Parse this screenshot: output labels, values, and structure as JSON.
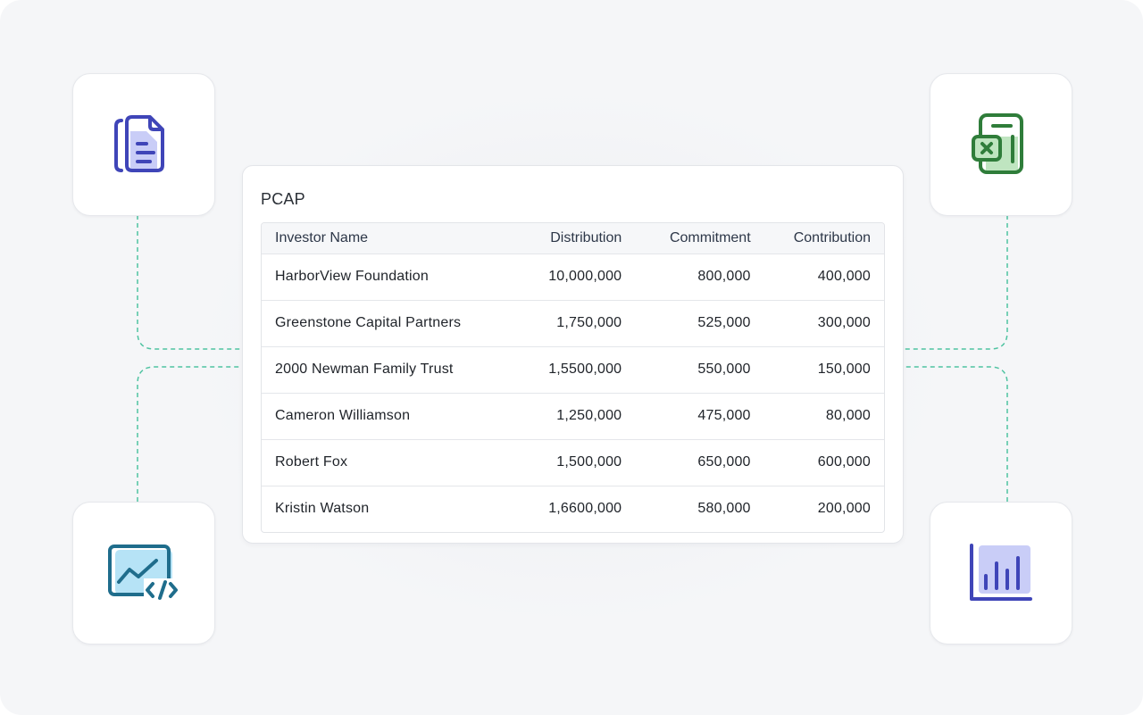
{
  "panel": {
    "title": "PCAP",
    "columns": {
      "name": "Investor Name",
      "distribution": "Distribution",
      "commitment": "Commitment",
      "contribution": "Contribution"
    },
    "rows": [
      {
        "name": "HarborView Foundation",
        "distribution": "10,000,000",
        "commitment": "800,000",
        "contribution": "400,000"
      },
      {
        "name": "Greenstone Capital Partners",
        "distribution": "1,750,000",
        "commitment": "525,000",
        "contribution": "300,000"
      },
      {
        "name": "2000 Newman Family Trust",
        "distribution": "1,5500,000",
        "commitment": "550,000",
        "contribution": "150,000"
      },
      {
        "name": "Cameron Williamson",
        "distribution": "1,250,000",
        "commitment": "475,000",
        "contribution": "80,000"
      },
      {
        "name": "Robert Fox",
        "distribution": "1,500,000",
        "commitment": "650,000",
        "contribution": "600,000"
      },
      {
        "name": "Kristin Watson",
        "distribution": "1,6600,000",
        "commitment": "580,000",
        "contribution": "200,000"
      }
    ]
  },
  "icons": {
    "top_left": "document-icon",
    "top_right": "spreadsheet-icon",
    "bottom_left": "code-chart-icon",
    "bottom_right": "bar-chart-icon"
  },
  "colors": {
    "connector": "#4fc3a1",
    "document": "#3f45b8",
    "spreadsheet": "#2f7d3a",
    "code_chart": "#1f6d8c",
    "bar_chart": "#3f45b8"
  }
}
